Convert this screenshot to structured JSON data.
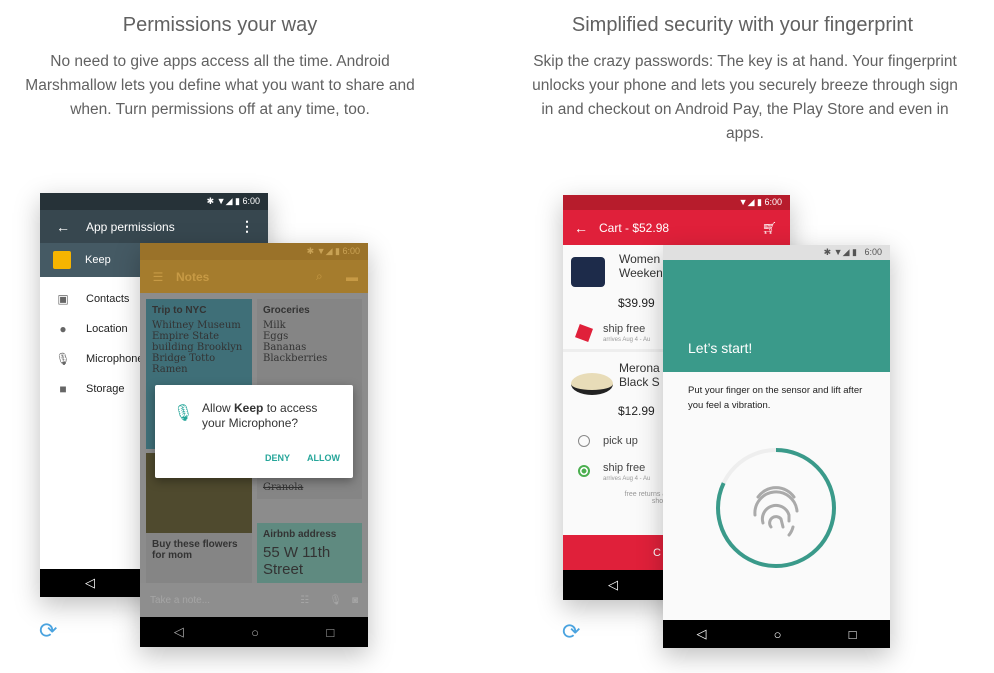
{
  "left": {
    "title": "Permissions your way",
    "text": "No need to give apps access all the time. Android Marshmallow lets you define what you want to share and when. Turn permissions off at any time, too.",
    "back_phone": {
      "time": "6:00",
      "toolbar_title": "App permissions",
      "app_name": "Keep",
      "items": [
        {
          "icon": "contacts-icon",
          "label": "Contacts"
        },
        {
          "icon": "location-icon",
          "label": "Location"
        },
        {
          "icon": "microphone-icon",
          "label": "Microphone"
        },
        {
          "icon": "folder-icon",
          "label": "Storage"
        }
      ]
    },
    "front_phone": {
      "time": "6:00",
      "toolbar_title": "Notes",
      "notes": [
        {
          "title": "Trip to NYC",
          "body": "Whitney Museum Empire State building Brooklyn Bridge Totto Ramen"
        },
        {
          "title": "Groceries",
          "items": [
            "Milk",
            "Eggs",
            "Bananas",
            "Blackberries"
          ],
          "done": "Granola"
        },
        {
          "title": "Buy these flowers for mom"
        },
        {
          "title": "Airbnb address",
          "body": "55 W 11th Street"
        }
      ],
      "input_placeholder": "Take a note...",
      "dialog": {
        "pre": "Allow ",
        "app": "Keep",
        "post": " to access your Microphone?",
        "deny": "DENY",
        "allow": "ALLOW"
      }
    }
  },
  "right": {
    "title": "Simplified security with your fingerprint",
    "text": "Skip the crazy passwords: The key is at hand. Your fingerprint unlocks your phone and lets you securely breeze through sign in and checkout on Android Pay, the Play Store and even in apps.",
    "back_phone": {
      "time": "6:00",
      "toolbar_title": "Cart - $52.98",
      "items": [
        {
          "name": "Women Weeken",
          "price": "$39.99"
        },
        {
          "name": "Merona Black S",
          "price": "$12.99"
        }
      ],
      "ship1": "ship free",
      "ship1_sub": "arrives Aug 4 - Au",
      "pickup": "pick up",
      "ship2": "ship free",
      "ship2_sub": "arrives Aug 4 - Au",
      "returns": "free returns & shop",
      "checkout": "C"
    },
    "front_phone": {
      "time": "6:00",
      "header": "Let’s start!",
      "instruction": "Put your finger on the sensor and lift after you feel a vibration.",
      "progress_percent": 82
    }
  },
  "colors": {
    "teal": "#3a9a8a",
    "red": "#e0203a",
    "sync": "#4aa3df"
  }
}
